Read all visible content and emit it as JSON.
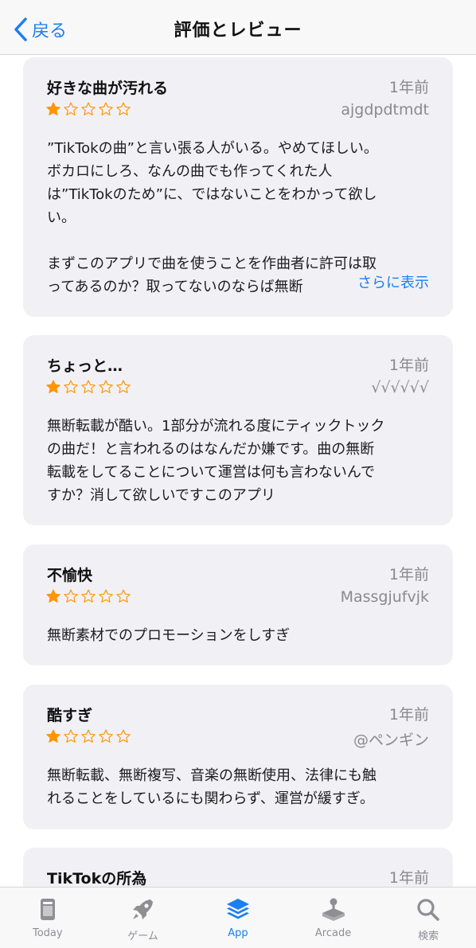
{
  "nav": {
    "back_label": "戻る",
    "title": "評価とレビュー"
  },
  "reviews": [
    {
      "title": "好きな曲が汚れる",
      "date": "1年前",
      "rating": 1,
      "author": "ajgdpdtmdt",
      "body": "”TikTokの曲”と言い張る人がいる。やめてほしい。\nボカロにしろ、なんの曲でも作ってくれた人\nは”TikTokのため”に、ではないことをわかって欲し\nい。\n\nまずこのアプリで曲を使うことを作曲者に許可は取\nってあるのか？取ってないのならば無断",
      "more": "さらに表示"
    },
    {
      "title": "ちょっと…",
      "date": "1年前",
      "rating": 1,
      "author": "√√√√√√",
      "body": "無断転載が酷い。1部分が流れる度にティックトック\nの曲だ！と言われるのはなんだか嫌です。曲の無断\n転載をしてることについて運営は何も言わないんで\nすか？消して欲しいですこのアプリ"
    },
    {
      "title": "不愉快",
      "date": "1年前",
      "rating": 1,
      "author": "Massgjufvjk",
      "body": "無断素材でのプロモーションをしすぎ"
    },
    {
      "title": "酷すぎ",
      "date": "1年前",
      "rating": 1,
      "author": "@ペンギン",
      "body": "無断転載、無断複写、音楽の無断使用、法律にも触\nれることをしているにも関わらず、運営が緩すぎ。"
    },
    {
      "title": "TikTokの所為",
      "date": "1年前"
    }
  ],
  "colors": {
    "star": "#ff9500",
    "accent": "#1a7ff0",
    "secondary": "#8a8a8e"
  },
  "tabbar": [
    {
      "label": "Today",
      "icon": "today-icon",
      "active": false
    },
    {
      "label": "ゲーム",
      "icon": "rocket-icon",
      "active": false
    },
    {
      "label": "App",
      "icon": "app-stack-icon",
      "active": true
    },
    {
      "label": "Arcade",
      "icon": "joystick-icon",
      "active": false
    },
    {
      "label": "検索",
      "icon": "search-icon",
      "active": false
    }
  ]
}
